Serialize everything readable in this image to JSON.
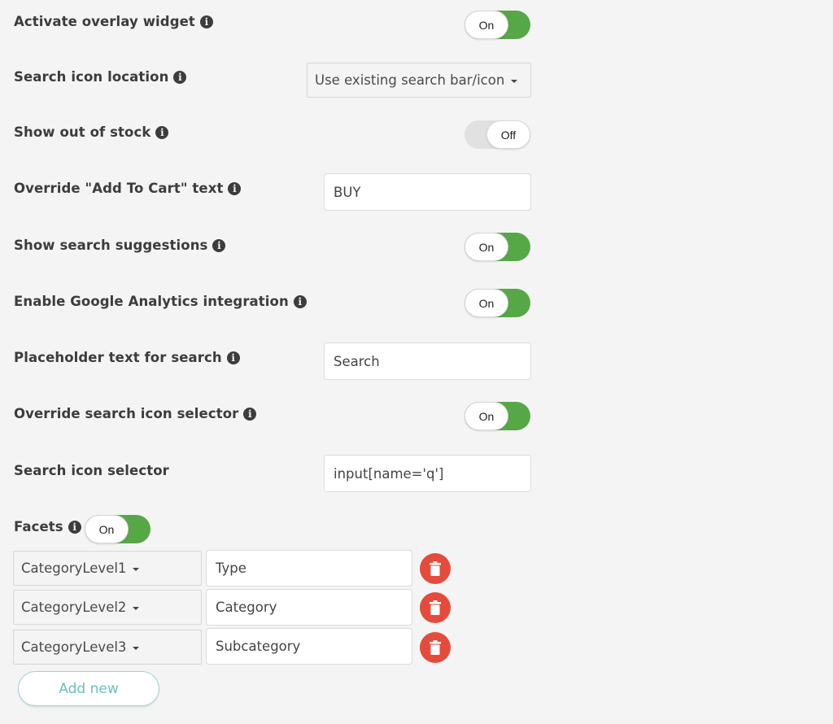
{
  "settings": {
    "activate_overlay": {
      "label": "Activate overlay widget",
      "state": "On"
    },
    "search_icon_location": {
      "label": "Search icon location",
      "selected": "Use existing search bar/icon"
    },
    "show_out_of_stock": {
      "label": "Show out of stock",
      "state": "Off"
    },
    "override_add_to_cart": {
      "label": "Override \"Add To Cart\" text",
      "value": "BUY"
    },
    "show_search_suggestions": {
      "label": "Show search suggestions",
      "state": "On"
    },
    "google_analytics": {
      "label": "Enable Google Analytics integration",
      "state": "On"
    },
    "placeholder_text": {
      "label": "Placeholder text for search",
      "value": "Search"
    },
    "override_search_icon_selector": {
      "label": "Override search icon selector",
      "state": "On"
    },
    "search_icon_selector": {
      "label": "Search icon selector",
      "value": "input[name='q']"
    }
  },
  "facets": {
    "label": "Facets",
    "state": "On",
    "rows": [
      {
        "field": "CategoryLevel1",
        "display": "Type"
      },
      {
        "field": "CategoryLevel2",
        "display": "Category"
      },
      {
        "field": "CategoryLevel3",
        "display": "Subcategory"
      }
    ],
    "add_new_label": "Add new"
  },
  "icons": {
    "info": "info-circle-icon",
    "delete": "trash-icon",
    "caret": "caret-down-icon"
  },
  "colors": {
    "toggle_on": "#56a846",
    "toggle_off": "#e1e1e1",
    "delete": "#e54b3c",
    "add_new": "#6cbfbd",
    "background": "#f4f4f4"
  }
}
